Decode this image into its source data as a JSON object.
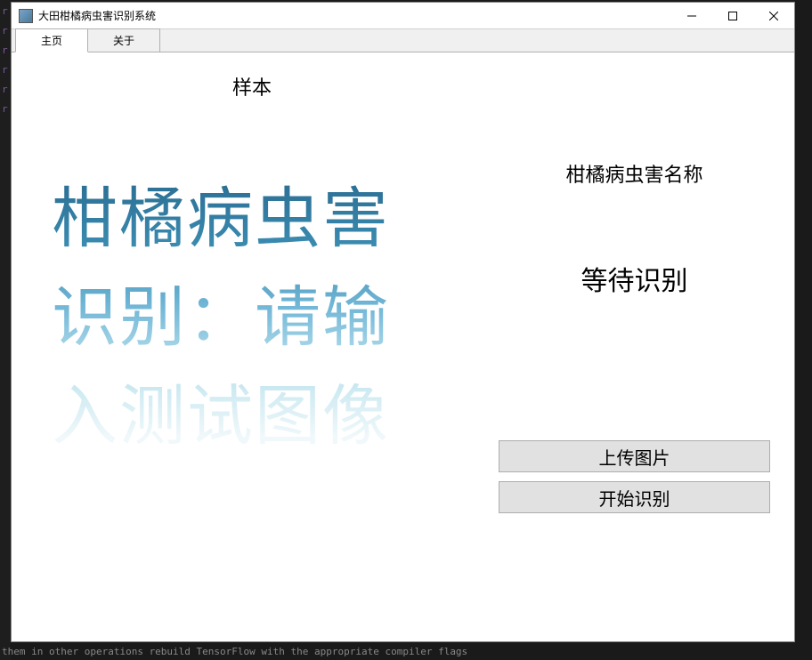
{
  "window": {
    "title": "大田柑橘病虫害识别系统"
  },
  "tabs": [
    {
      "label": "主页",
      "active": true
    },
    {
      "label": "关于",
      "active": false
    }
  ],
  "main": {
    "sample_label": "样本",
    "placeholder_text": "柑橘病虫害识别：请输入测试图像",
    "disease_name_label": "柑橘病虫害名称",
    "status_text": "等待识别",
    "upload_button": "上传图片",
    "start_button": "开始识别"
  },
  "icons": {
    "minimize": "minimize-icon",
    "maximize": "maximize-icon",
    "close": "close-icon",
    "app": "app-icon"
  }
}
